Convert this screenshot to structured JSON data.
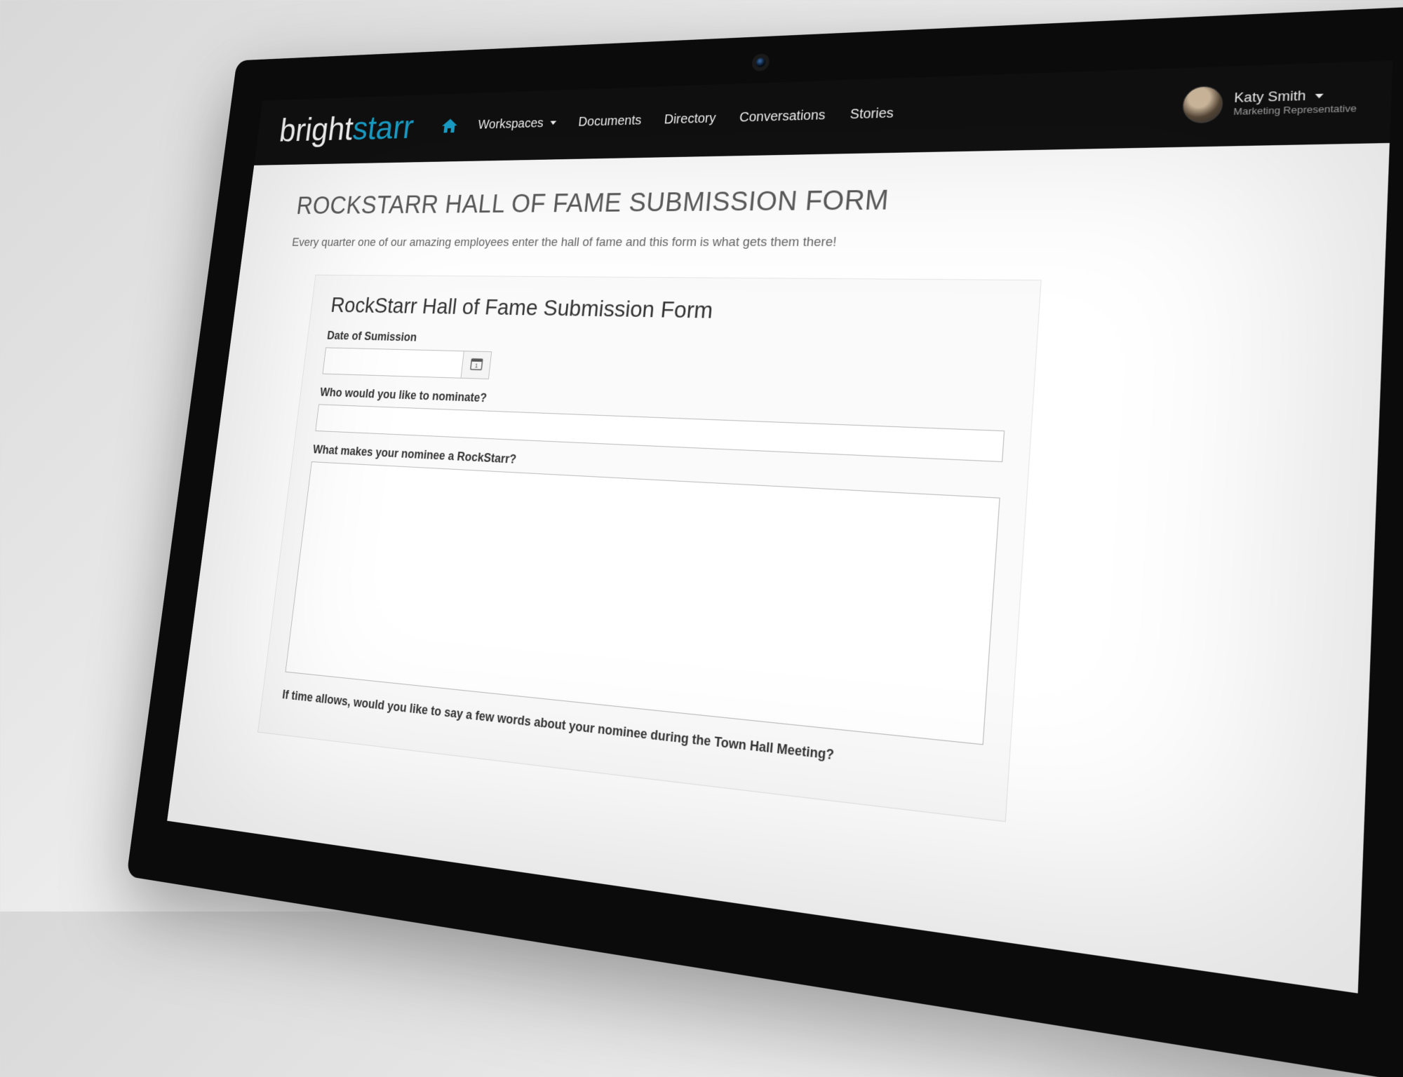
{
  "brand": {
    "part1": "bright",
    "part2": "starr"
  },
  "nav": {
    "workspaces": "Workspaces",
    "documents": "Documents",
    "directory": "Directory",
    "conversations": "Conversations",
    "stories": "Stories"
  },
  "user": {
    "name": "Katy Smith",
    "role": "Marketing Representative"
  },
  "page": {
    "title": "ROCKSTARR HALL OF FAME SUBMISSION FORM",
    "subtitle": "Every quarter one of our amazing employees enter the hall of fame and this form is what gets them there!"
  },
  "form": {
    "title": "RockStarr Hall of Fame Submission Form",
    "fields": {
      "date_label": "Date of Sumission",
      "date_value": "",
      "nominee_label": "Who would you like to nominate?",
      "nominee_value": "",
      "reason_label": "What makes your nominee a RockStarr?",
      "reason_value": "",
      "townhall_label": "If time allows, would you like to say a few words about your nominee during the Town Hall Meeting?"
    }
  }
}
